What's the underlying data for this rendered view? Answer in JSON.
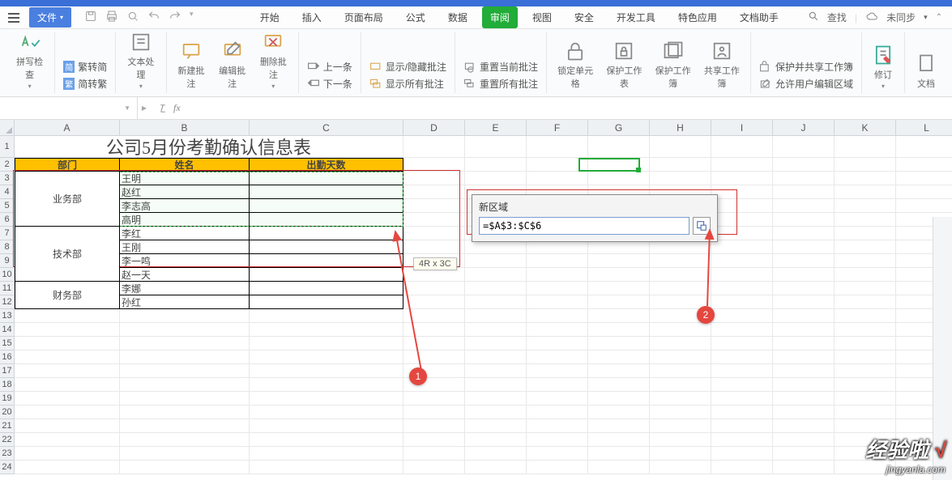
{
  "menubar": {
    "file_label": "文件",
    "tabs": [
      "开始",
      "插入",
      "页面布局",
      "公式",
      "数据",
      "审阅",
      "视图",
      "安全",
      "开发工具",
      "特色应用",
      "文档助手"
    ],
    "active_tab_index": 5,
    "search": "查找",
    "sync": "未同步",
    "cloud_caret": "▾"
  },
  "ribbon": {
    "spellcheck": "拼写检查",
    "fan_to_jian": "繁转简",
    "jian_to_fan": "简转繁",
    "text_proc": "文本处理",
    "new_comment": "新建批注",
    "edit_comment": "编辑批注",
    "delete_comment": "删除批注",
    "prev": "上一条",
    "next": "下一条",
    "show_hide": "显示/隐藏批注",
    "show_all": "显示所有批注",
    "reset_current": "重置当前批注",
    "reset_all": "重置所有批注",
    "lock_cell": "锁定单元格",
    "protect_sheet": "保护工作表",
    "protect_book": "保护工作簿",
    "share_book": "共享工作簿",
    "protect_share": "保护并共享工作簿",
    "allow_edit_range": "允许用户编辑区域",
    "revise": "修订",
    "doc": "文档"
  },
  "fx": {
    "name": "",
    "formula": ""
  },
  "columns": [
    "A",
    "B",
    "C",
    "D",
    "E",
    "F",
    "G",
    "H",
    "I",
    "J",
    "K",
    "L"
  ],
  "sheet": {
    "title": "公司5月份考勤确认信息表",
    "headers": [
      "部门",
      "姓名",
      "出勤天数"
    ],
    "rows": [
      {
        "dept": "业务部",
        "name": "王明"
      },
      {
        "dept": "",
        "name": "赵红"
      },
      {
        "dept": "",
        "name": "李志高"
      },
      {
        "dept": "",
        "name": "高明"
      },
      {
        "dept": "技术部",
        "name": "李红"
      },
      {
        "dept": "",
        "name": "王刚"
      },
      {
        "dept": "",
        "name": "李一鸣"
      },
      {
        "dept": "",
        "name": "赵一天"
      },
      {
        "dept": "财务部",
        "name": "李娜"
      },
      {
        "dept": "",
        "name": "孙红"
      }
    ]
  },
  "selection_hint": "4R x 3C",
  "dialog": {
    "title": "新区域",
    "value": "=$A$3:$C$6"
  },
  "annotations": {
    "a1": "1",
    "a2": "2"
  },
  "watermark": {
    "line1": "经验啦",
    "check": "√",
    "line2": "jingyanla.com"
  },
  "active_cell": "G2"
}
